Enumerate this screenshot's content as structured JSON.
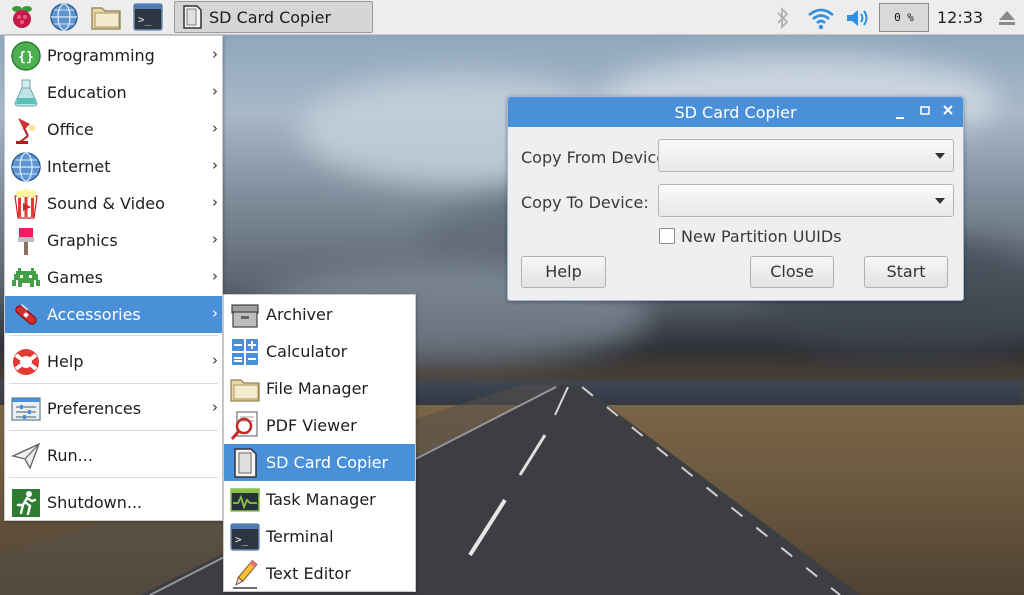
{
  "taskbar": {
    "launchers": [
      {
        "icon": "raspberry-menu-icon"
      },
      {
        "icon": "web-browser-icon"
      },
      {
        "icon": "file-manager-icon"
      },
      {
        "icon": "terminal-icon"
      }
    ],
    "task_button_label": "SD Card Copier",
    "cpu_usage": "0 %",
    "clock": "12:33",
    "tray_icons": [
      "bluetooth-icon",
      "wifi-icon",
      "volume-icon",
      "eject-icon"
    ]
  },
  "menu": {
    "items": [
      {
        "label": "Programming",
        "icon": "programming-icon",
        "submenu": true
      },
      {
        "label": "Education",
        "icon": "education-icon",
        "submenu": true
      },
      {
        "label": "Office",
        "icon": "office-icon",
        "submenu": true
      },
      {
        "label": "Internet",
        "icon": "internet-icon",
        "submenu": true
      },
      {
        "label": "Sound & Video",
        "icon": "sound-video-icon",
        "submenu": true
      },
      {
        "label": "Graphics",
        "icon": "graphics-icon",
        "submenu": true
      },
      {
        "label": "Games",
        "icon": "games-icon",
        "submenu": true
      },
      {
        "label": "Accessories",
        "icon": "accessories-icon",
        "submenu": true,
        "selected": true
      },
      {
        "label": "Help",
        "icon": "help-icon",
        "submenu": true
      },
      {
        "label": "Preferences",
        "icon": "preferences-icon",
        "submenu": true
      },
      {
        "label": "Run...",
        "icon": "run-icon",
        "submenu": false
      },
      {
        "label": "Shutdown...",
        "icon": "shutdown-icon",
        "submenu": false
      }
    ],
    "arrow_glyph": "›"
  },
  "submenu": {
    "items": [
      {
        "label": "Archiver",
        "icon": "archiver-icon"
      },
      {
        "label": "Calculator",
        "icon": "calculator-icon"
      },
      {
        "label": "File Manager",
        "icon": "file-manager-icon"
      },
      {
        "label": "PDF Viewer",
        "icon": "pdf-viewer-icon"
      },
      {
        "label": "SD Card Copier",
        "icon": "sd-card-icon",
        "selected": true
      },
      {
        "label": "Task Manager",
        "icon": "task-manager-icon"
      },
      {
        "label": "Terminal",
        "icon": "terminal-icon"
      },
      {
        "label": "Text Editor",
        "icon": "text-editor-icon"
      }
    ]
  },
  "dialog": {
    "title": "SD Card Copier",
    "copy_from_label": "Copy From Device:",
    "copy_from_value": "",
    "copy_to_label": "Copy To Device:",
    "copy_to_value": "",
    "new_partition_label": "New Partition UUIDs",
    "new_partition_checked": false,
    "help_label": "Help",
    "close_label": "Close",
    "start_label": "Start"
  },
  "colors": {
    "accent": "#4a90d9",
    "panel": "#ededed",
    "dialog_bg": "#efefef"
  }
}
